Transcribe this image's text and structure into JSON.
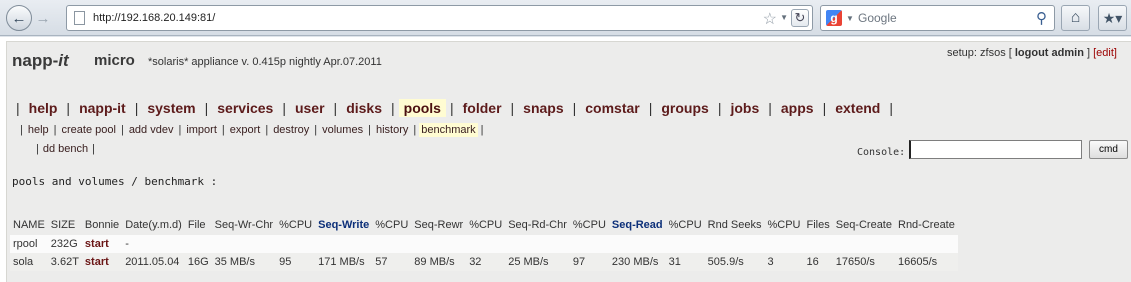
{
  "browser": {
    "url": "http://192.168.20.149:81/",
    "search_placeholder": "Google",
    "icons": {
      "back": "back-arrow-icon",
      "forward": "forward-arrow-icon",
      "page": "page-icon",
      "star": "star-icon",
      "reload": "reload-icon",
      "search_engine": "google-icon",
      "search": "magnifier-icon",
      "home": "home-icon",
      "bookmarks": "bookmarks-icon"
    }
  },
  "header": {
    "brand_part1": "napp-",
    "brand_part2": "it",
    "edition": "micro",
    "version": "*solaris* appliance v. 0.415p nightly Apr.07.2011",
    "setup_label": "setup: zfsos [",
    "logout": "logout admin",
    "bracket_close": "]",
    "edit": "[edit]"
  },
  "main_menu": [
    {
      "label": "help",
      "active": false
    },
    {
      "label": "napp-it",
      "active": false
    },
    {
      "label": "system",
      "active": false
    },
    {
      "label": "services",
      "active": false
    },
    {
      "label": "user",
      "active": false
    },
    {
      "label": "disks",
      "active": false
    },
    {
      "label": "pools",
      "active": true
    },
    {
      "label": "folder",
      "active": false
    },
    {
      "label": "snaps",
      "active": false
    },
    {
      "label": "comstar",
      "active": false
    },
    {
      "label": "groups",
      "active": false
    },
    {
      "label": "jobs",
      "active": false
    },
    {
      "label": "apps",
      "active": false
    },
    {
      "label": "extend",
      "active": false
    }
  ],
  "sub_menu": [
    {
      "label": "help",
      "active": false
    },
    {
      "label": "create pool",
      "active": false
    },
    {
      "label": "add vdev",
      "active": false
    },
    {
      "label": "import",
      "active": false
    },
    {
      "label": "export",
      "active": false
    },
    {
      "label": "destroy",
      "active": false
    },
    {
      "label": "volumes",
      "active": false
    },
    {
      "label": "history",
      "active": false
    },
    {
      "label": "benchmark",
      "active": true
    }
  ],
  "sub_menu_2": {
    "label": "dd bench"
  },
  "console": {
    "label": "Console:",
    "value": "",
    "button": "cmd"
  },
  "section_title": "pools and volumes / benchmark :",
  "table": {
    "headers": [
      "NAME",
      "SIZE",
      "Bonnie",
      "Date(y.m.d)",
      "File",
      "Seq-Wr-Chr",
      "%CPU",
      "Seq-Write",
      "%CPU",
      "Seq-Rewr",
      "%CPU",
      "Seq-Rd-Chr",
      "%CPU",
      "Seq-Read",
      "%CPU",
      "Rnd Seeks",
      "%CPU",
      "Files",
      "Seq-Create",
      "Rnd-Create"
    ],
    "highlight_columns": [
      "Seq-Write",
      "Seq-Read"
    ],
    "rows": [
      [
        "rpool",
        "232G",
        "start",
        "-",
        "",
        "",
        "",
        "",
        "",
        "",
        "",
        "",
        "",
        "",
        "",
        "",
        "",
        "",
        "",
        ""
      ],
      [
        "sola",
        "3.62T",
        "start",
        "2011.05.04",
        "16G",
        "35 MB/s",
        "95",
        "171 MB/s",
        "57",
        "89 MB/s",
        "32",
        "25 MB/s",
        "97",
        "230 MB/s",
        "31",
        "505.9/s",
        "3",
        "16",
        "17650/s",
        "16605/s"
      ]
    ]
  },
  "colors": {
    "menu_link": "#5d1b1b",
    "active_tab": "#fffcd2",
    "highlight_header": "#0c2f79",
    "page_background": "#ececeb"
  }
}
